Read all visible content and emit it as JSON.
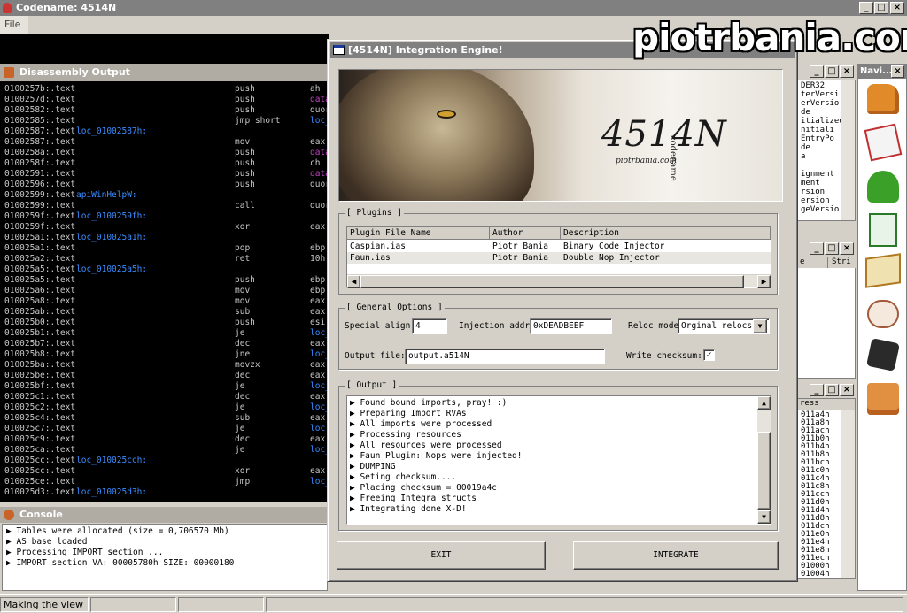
{
  "app": {
    "title": "Codename: 4514N",
    "menu_file": "File"
  },
  "disasm": {
    "title": "Disassembly Output",
    "rows": [
      {
        "addr": "0100257b:.text",
        "label": "",
        "mnem": "push",
        "op": "ah"
      },
      {
        "addr": "0100257d:.text",
        "label": "",
        "mnem": "push",
        "op": "data"
      },
      {
        "addr": "01002582:.text",
        "label": "",
        "mnem": "push",
        "op": "duor"
      },
      {
        "addr": "01002585:.text",
        "label": "",
        "mnem": "jmp short",
        "op": "loc_"
      },
      {
        "addr": "01002587:.text",
        "label": "loc_01002587h:",
        "mnem": "",
        "op": ""
      },
      {
        "addr": "01002587:.text",
        "label": "",
        "mnem": "mov",
        "op": "eax,"
      },
      {
        "addr": "0100258a:.text",
        "label": "",
        "mnem": "push",
        "op": "data"
      },
      {
        "addr": "0100258f:.text",
        "label": "",
        "mnem": "push",
        "op": "ch"
      },
      {
        "addr": "01002591:.text",
        "label": "",
        "mnem": "push",
        "op": "data"
      },
      {
        "addr": "01002596:.text",
        "label": "",
        "mnem": "push",
        "op": "duor"
      },
      {
        "addr": "01002599:.text",
        "label": "apiWinHelpW:",
        "mnem": "",
        "op": ""
      },
      {
        "addr": "01002599:.text",
        "label": "",
        "mnem": "call",
        "op": "duor"
      },
      {
        "addr": "0100259f:.text",
        "label": "loc_0100259fh:",
        "mnem": "",
        "op": ""
      },
      {
        "addr": "0100259f:.text",
        "label": "",
        "mnem": "xor",
        "op": "eax,"
      },
      {
        "addr": "010025a1:.text",
        "label": "loc_010025a1h:",
        "mnem": "",
        "op": ""
      },
      {
        "addr": "010025a1:.text",
        "label": "",
        "mnem": "pop",
        "op": "ebp"
      },
      {
        "addr": "010025a2:.text",
        "label": "",
        "mnem": "ret",
        "op": "10h"
      },
      {
        "addr": "010025a5:.text",
        "label": "loc_010025a5h:",
        "mnem": "",
        "op": ""
      },
      {
        "addr": "010025a5:.text",
        "label": "",
        "mnem": "push",
        "op": "ebp"
      },
      {
        "addr": "010025a6:.text",
        "label": "",
        "mnem": "mov",
        "op": "ebp,"
      },
      {
        "addr": "010025a8:.text",
        "label": "",
        "mnem": "mov",
        "op": "eax,"
      },
      {
        "addr": "010025ab:.text",
        "label": "",
        "mnem": "sub",
        "op": "eax,"
      },
      {
        "addr": "010025b0:.text",
        "label": "",
        "mnem": "push",
        "op": "esi"
      },
      {
        "addr": "010025b1:.text",
        "label": "",
        "mnem": "je",
        "op": "loc_"
      },
      {
        "addr": "010025b7:.text",
        "label": "",
        "mnem": "dec",
        "op": "eax"
      },
      {
        "addr": "010025b8:.text",
        "label": "",
        "mnem": "jne",
        "op": "loc_"
      },
      {
        "addr": "010025ba:.text",
        "label": "",
        "mnem": "movzx",
        "op": "eax,"
      },
      {
        "addr": "010025be:.text",
        "label": "",
        "mnem": "dec",
        "op": "eax"
      },
      {
        "addr": "010025bf:.text",
        "label": "",
        "mnem": "je",
        "op": "loc_"
      },
      {
        "addr": "010025c1:.text",
        "label": "",
        "mnem": "dec",
        "op": "eax"
      },
      {
        "addr": "010025c2:.text",
        "label": "",
        "mnem": "je",
        "op": "loc_"
      },
      {
        "addr": "010025c4:.text",
        "label": "",
        "mnem": "sub",
        "op": "eax,"
      },
      {
        "addr": "010025c7:.text",
        "label": "",
        "mnem": "je",
        "op": "loc_"
      },
      {
        "addr": "010025c9:.text",
        "label": "",
        "mnem": "dec",
        "op": "eax"
      },
      {
        "addr": "010025ca:.text",
        "label": "",
        "mnem": "je",
        "op": "loc_"
      },
      {
        "addr": "010025cc:.text",
        "label": "loc_010025cch:",
        "mnem": "",
        "op": ""
      },
      {
        "addr": "010025cc:.text",
        "label": "",
        "mnem": "xor",
        "op": "eax,"
      },
      {
        "addr": "010025ce:.text",
        "label": "",
        "mnem": "jmp",
        "op": "loc_"
      },
      {
        "addr": "010025d3:.text",
        "label": "loc_010025d3h:",
        "mnem": "",
        "op": ""
      }
    ]
  },
  "console": {
    "title": "Console",
    "lines": [
      "Tables were allocated (size = 0,706570 Mb)",
      "AS base loaded",
      "Processing IMPORT section ...",
      "IMPORT section VA: 00005780h SIZE: 00000180"
    ]
  },
  "status": {
    "text": "Making the view ..."
  },
  "watermark": "piotrbania.com",
  "right_panes": {
    "top_lines": [
      "DER32",
      "terVersi",
      "erVersio",
      "de",
      "itialized",
      "nitiali",
      "EntryPo",
      "de",
      "a",
      "",
      "ignment",
      "ment",
      "rsion",
      "ersion",
      "geVersio"
    ],
    "middle_header": [
      "e",
      "Stri"
    ],
    "bottom_header": "ress",
    "bottom_lines": [
      "011a4h",
      "011a8h",
      "011ach",
      "011b0h",
      "011b4h",
      "011b8h",
      "011bch",
      "011c0h",
      "011c4h",
      "011c8h",
      "011cch",
      "011d0h",
      "011d4h",
      "011d8h",
      "011dch",
      "011e0h",
      "011e4h",
      "011e8h",
      "011ech",
      "01000h",
      "01004h"
    ],
    "navi_title": "Navi..."
  },
  "dialog": {
    "title": "[4514N] Integration Engine!",
    "banner": {
      "logo": "4514N",
      "logo_sub": "codename",
      "site": "piotrbania.com"
    },
    "plugins": {
      "group": "[ Plugins ]",
      "headers": [
        "Plugin File Name",
        "Author",
        "Description"
      ],
      "rows": [
        [
          "Caspian.ias",
          "Piotr Bania",
          "Binary Code Injector"
        ],
        [
          "Faun.ias",
          "Piotr Bania",
          "Double Nop Injector"
        ]
      ]
    },
    "options": {
      "group": "[ General Options ]",
      "special_align_label": "Special align:",
      "special_align_value": "4",
      "injection_label": "Injection addr:",
      "injection_value": "0xDEADBEEF",
      "reloc_label": "Reloc mode:",
      "reloc_value": "Orginal relocs f",
      "output_label": "Output file:",
      "output_value": "output.a514N",
      "checksum_label": "Write checksum:",
      "checksum_mark": "✓"
    },
    "output": {
      "group": "[ Output ]",
      "lines": [
        "Found bound imports, pray! :)",
        "Preparing Import RVAs",
        "All imports were processed",
        "Processing resources",
        "All resources were processed",
        "Faun Plugin: Nops were injected!",
        "DUMPING",
        "Seting checksum....",
        "Placing checksum = 00019a4c",
        "Freeing Integra structs",
        "Integrating done X-D!"
      ]
    },
    "exit_label": "EXIT",
    "integrate_label": "INTEGRATE"
  },
  "colors": {
    "title_inactive": "#808080",
    "chrome": "#d4d0c8",
    "label_blue": "#3a8cff",
    "data_purple": "#c040c0"
  }
}
